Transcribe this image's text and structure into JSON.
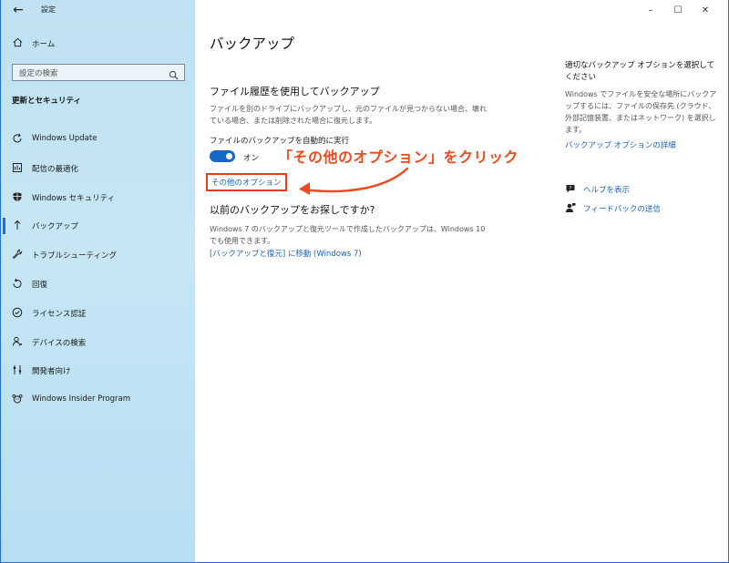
{
  "window": {
    "app_title": "設定",
    "controls": {
      "minimize": "–",
      "maximize": "☐",
      "close": "✕"
    }
  },
  "sidebar": {
    "back_glyph": "←",
    "home": {
      "label": "ホーム",
      "icon": "home-icon"
    },
    "search": {
      "placeholder": "設定の検索",
      "icon": "search-icon"
    },
    "section_title": "更新とセキュリティ",
    "items": [
      {
        "label": "Windows Update",
        "icon": "refresh-icon",
        "selected": false
      },
      {
        "label": "配信の最適化",
        "icon": "delivery-icon",
        "selected": false
      },
      {
        "label": "Windows セキュリティ",
        "icon": "shield-icon",
        "selected": false
      },
      {
        "label": "バックアップ",
        "icon": "backup-icon",
        "selected": true
      },
      {
        "label": "トラブルシューティング",
        "icon": "wrench-icon",
        "selected": false
      },
      {
        "label": "回復",
        "icon": "recovery-icon",
        "selected": false
      },
      {
        "label": "ライセンス認証",
        "icon": "check-circle-icon",
        "selected": false
      },
      {
        "label": "デバイスの検索",
        "icon": "person-pin-icon",
        "selected": false
      },
      {
        "label": "開発者向け",
        "icon": "developer-icon",
        "selected": false
      },
      {
        "label": "Windows Insider Program",
        "icon": "insider-icon",
        "selected": false
      }
    ]
  },
  "main": {
    "title": "バックアップ",
    "file_history": {
      "heading": "ファイル履歴を使用してバックアップ",
      "description": "ファイルを別のドライブにバックアップし、元のファイルが見つからない場合、壊れている場合、または削除された場合に復元します。",
      "auto_label": "ファイルのバックアップを自動的に実行",
      "toggle_state": "オン",
      "toggle_on": true,
      "more_options": "その他のオプション"
    },
    "annotation": "「その他のオプション」をクリック",
    "previous": {
      "heading": "以前のバックアップをお探しですか?",
      "description": "Windows 7 のバックアップと復元ツールで作成したバックアップは、Windows 10 でも使用できます。",
      "link": "[バックアップと復元] に移動 (Windows 7)"
    }
  },
  "right": {
    "title": "適切なバックアップ オプションを選択してください",
    "description": "Windows でファイルを安全な場所にバックアップするには、ファイルの保存先 (クラウド、外部記憶装置、またはネットワーク) を選択します。",
    "detail_link": "バックアップ オプションの詳細",
    "help": {
      "label": "ヘルプを表示",
      "icon": "help-chat-icon"
    },
    "feedback": {
      "label": "フィードバックの送信",
      "icon": "feedback-icon"
    }
  },
  "colors": {
    "accent": "#1767c6",
    "link": "#1b63b8",
    "annotation": "#ee4a1e",
    "sidebar_bg": "#c6e6f4"
  }
}
